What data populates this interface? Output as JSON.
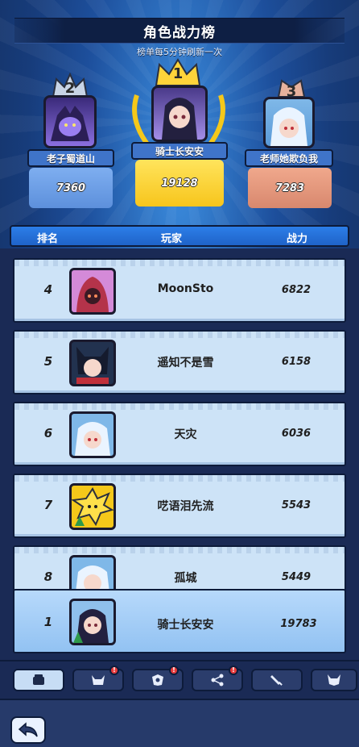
{
  "header": {
    "title": "角色战力榜",
    "subtitle": "榜单每5分钟刷新一次"
  },
  "podium": [
    {
      "rank": "2",
      "name": "老子蜀道山",
      "power": "7360"
    },
    {
      "rank": "1",
      "name": "骑士长安安",
      "power": "19128"
    },
    {
      "rank": "3",
      "name": "老师她欺负我",
      "power": "7283"
    }
  ],
  "columns": {
    "rank": "排名",
    "player": "玩家",
    "power": "战力"
  },
  "rows": [
    {
      "rank": "4",
      "name": "MoonSto",
      "power": "6822"
    },
    {
      "rank": "5",
      "name": "遥知不是雪",
      "power": "6158"
    },
    {
      "rank": "6",
      "name": "天灾",
      "power": "6036"
    },
    {
      "rank": "7",
      "name": "呓语泪先流",
      "power": "5543"
    },
    {
      "rank": "8",
      "name": "孤城",
      "power": "5449"
    }
  ],
  "self": {
    "rank": "1",
    "name": "骑士长安安",
    "power": "19783"
  },
  "tabs": [
    {
      "icon": "fist-icon",
      "active": true,
      "badge": false
    },
    {
      "icon": "horned-helmet-icon",
      "active": false,
      "badge": true
    },
    {
      "icon": "gem-shield-icon",
      "active": false,
      "badge": true
    },
    {
      "icon": "nodes-icon",
      "active": false,
      "badge": true
    },
    {
      "icon": "sword-icon",
      "active": false,
      "badge": false
    },
    {
      "icon": "demon-mask-icon",
      "active": false,
      "badge": false
    }
  ],
  "colors": {
    "first": "#f7c51c",
    "second": "#5d90dc",
    "third": "#d8886e",
    "header_blue": "#1f63c8",
    "row_bg": "#cde3f7"
  }
}
